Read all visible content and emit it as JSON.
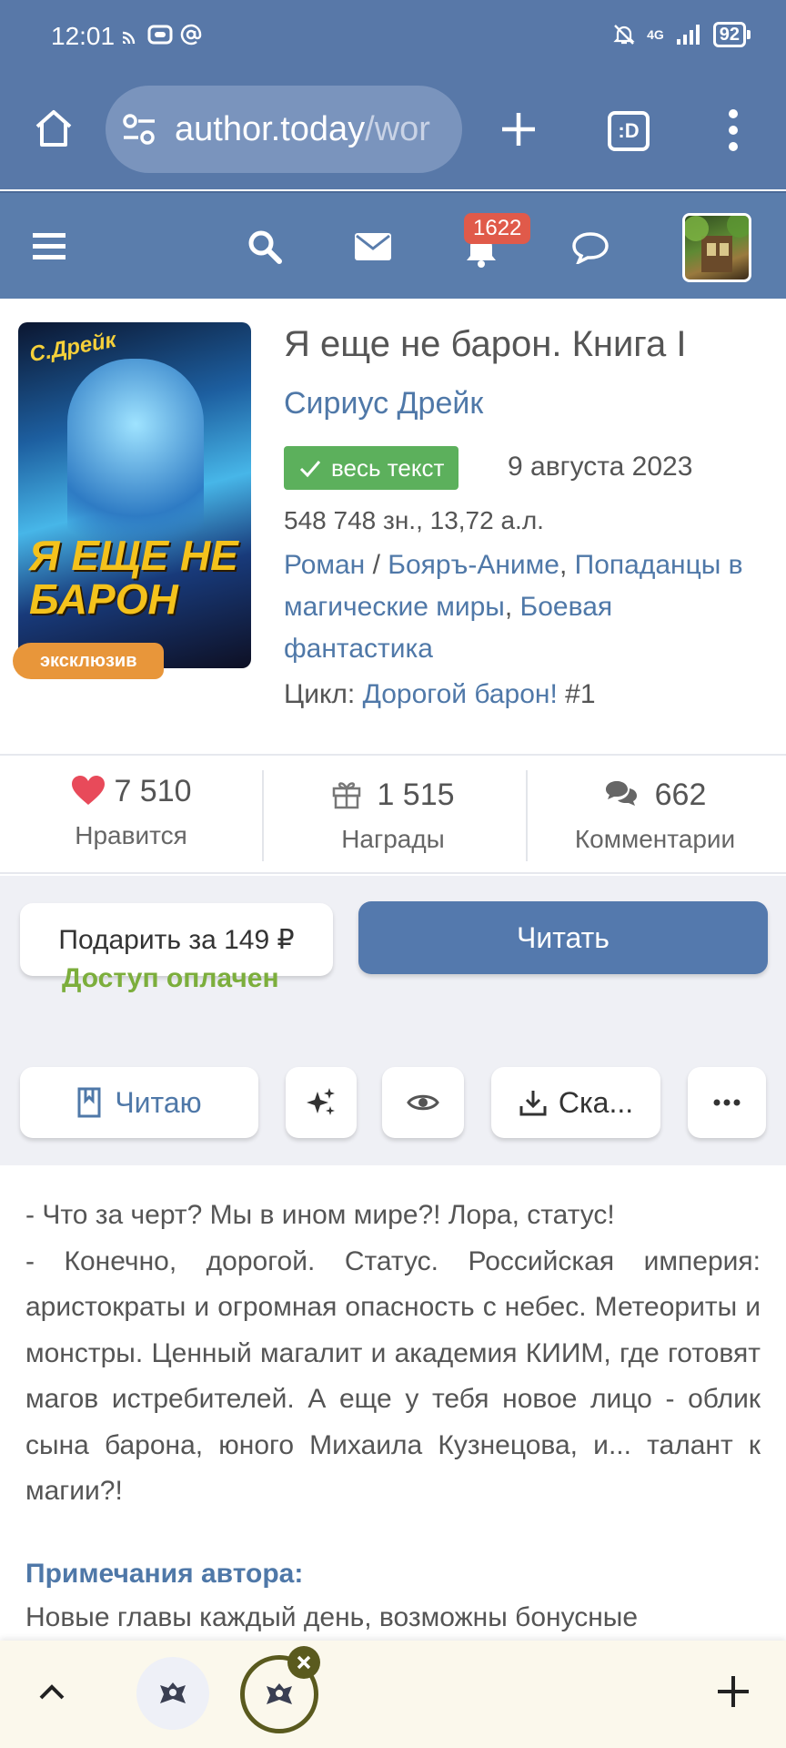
{
  "status_bar": {
    "time": "12:01",
    "signal_label": "4G",
    "battery": "92"
  },
  "browser": {
    "url_main": "author.today",
    "url_dim": "/wor",
    "tab_switcher_label": ":D"
  },
  "site_header": {
    "notifications_count": "1622"
  },
  "book": {
    "cover_author": "С.Дрейк",
    "cover_title": "Я ЕЩЕ НЕ БАРОН",
    "exclusive_badge": "эксклюзив",
    "title": "Я еще не барон. Книга I",
    "author": "Сириус Дрейк",
    "status_badge": "весь текст",
    "date": "9 августа 2023",
    "size": "548 748 зн., 13,72 а.л.",
    "genre_1": "Роман",
    "genre_sep": " / ",
    "genre_2": "Бояръ-Аниме",
    "genre_3": "Попаданцы в магические миры",
    "genre_4": "Боевая фантастика",
    "cycle_label": "Цикл: ",
    "cycle_name": "Дорогой барон!",
    "cycle_num": " #1"
  },
  "stats": {
    "likes_value": "7 510",
    "likes_label": "Нравится",
    "awards_value": "1 515",
    "awards_label": "Награды",
    "comments_value": "662",
    "comments_label": "Комментарии"
  },
  "actions": {
    "gift_label": "Подарить за 149 ₽",
    "read_label": "Читать",
    "access_paid": "Доступ оплачен",
    "reading_label": "Читаю",
    "download_label": "Ска..."
  },
  "annotation": {
    "para_1": "- Что за черт? Мы в ином мире?! Лора, статус!",
    "para_2": "- Конечно, дорогой. Статус. Российская империя: аристократы и огромная опасность с небес. Ме­теориты и монстры. Ценный магалит и академия КИИМ, где готовят магов истребителей. А еще у тебя новое лицо - облик сына барона, юного Миха­ила Кузнецова, и... талант к магии?!",
    "notes_heading": "Примечания автора:",
    "notes_text": "Новые главы каждый день, возможны бонусные"
  },
  "colors": {
    "brand_blue": "#5a7dac",
    "link_blue": "#4f78a8",
    "paid_green": "#7cae3c",
    "badge_red": "#e05a4a",
    "full_text_green": "#5cb05c",
    "exclusive_orange": "#e8963a"
  }
}
